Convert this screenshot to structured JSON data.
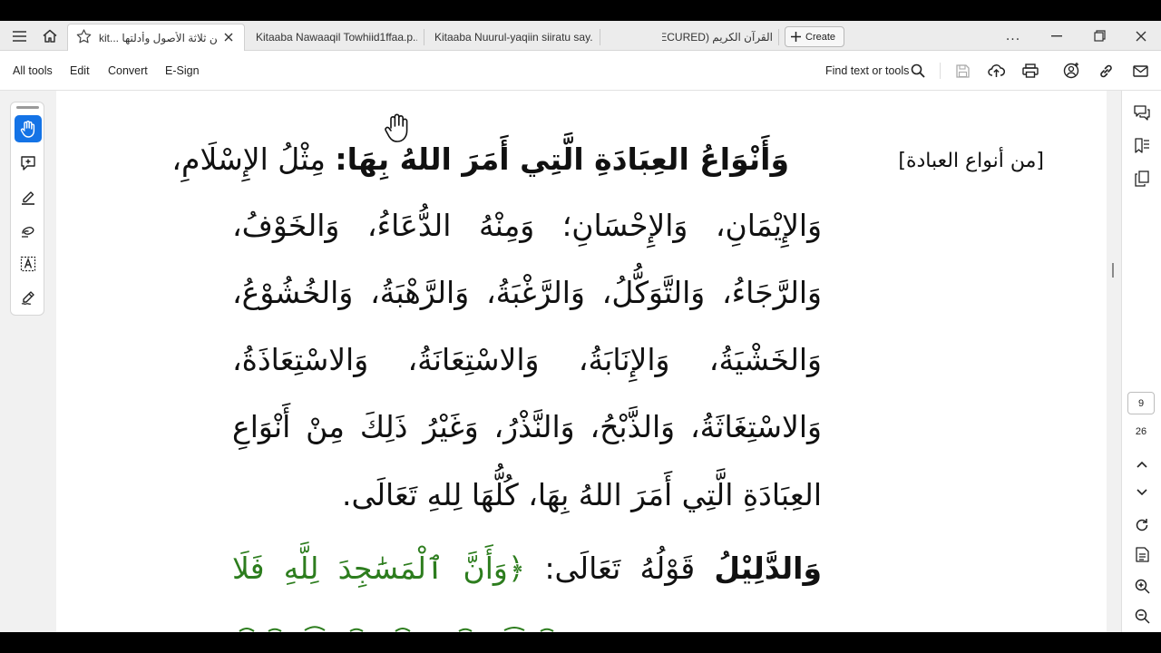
{
  "tabs": [
    {
      "title": "kit... متن ثلاثة الأصول وأدلتها",
      "active": true
    },
    {
      "title": "Kitaaba Nawaaqil Towhiid1ffaa.p...",
      "active": false
    },
    {
      "title": "Kitaaba Nuurul-yaqiin siiratu say...",
      "active": false
    },
    {
      "title": "القرآن الكريم (SECURED)",
      "active": false
    }
  ],
  "tabbar": {
    "create_label": "Create",
    "more_label": "..."
  },
  "menu": {
    "items": [
      "All tools",
      "Edit",
      "Convert",
      "E-Sign"
    ],
    "find_label": "Find text or tools"
  },
  "page_nav": {
    "current_page": "9",
    "total_pages": "26"
  },
  "document": {
    "margin_note": "[من أنواع العبادة]",
    "heading_bold": "وَأَنْوَاعُ العِبَادَةِ الَّتِي أَمَرَ اللهُ بِهَا:",
    "heading_rest": "مِثْلُ الإِسْلَامِ،",
    "lines": [
      "وَالإِيْمَانِ، وَالإِحْسَانِ؛ وَمِنْهُ الدُّعَاءُ، وَالخَوْفُ،",
      "وَالرَّجَاءُ، وَالتَّوَكُّلُ، وَالرَّغْبَةُ، وَالرَّهْبَةُ، وَالخُشُوْعُ،",
      "وَالخَشْيَةُ، وَالإِنَابَةُ، وَالاسْتِعَانَةُ، وَالاسْتِعَاذَةُ،",
      "وَالاسْتِغَاثَةُ، وَالذَّبْحُ، وَالنَّذْرُ، وَغَيْرُ ذَلِكَ مِنْ أَنْوَاعِ",
      "العِبَادَةِ الَّتِي أَمَرَ اللهُ بِهَا، كُلُّهَا لِلهِ تَعَالَى."
    ],
    "evidence_bold": "وَالدَّلِيْلُ",
    "evidence_rest": "قَوْلُهُ تَعَالَى:",
    "verse": "﴿وَأَنَّ ٱلْمَسَٰجِدَ لِلَّهِ فَلَا"
  },
  "colors": {
    "accent": "#1473e6",
    "verse": "#2d7d1e",
    "text": "#111111",
    "canvas": "#f1f1f1"
  }
}
